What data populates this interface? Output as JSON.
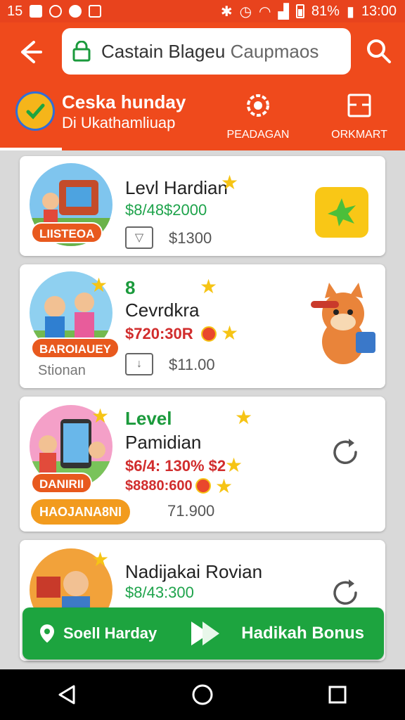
{
  "status_bar": {
    "left_number": "15",
    "battery_percent": "81%",
    "time": "13:00"
  },
  "header": {
    "search_value": "Castain Blageu",
    "search_placeholder": "Caupmaos",
    "active_tab": {
      "title": "Ceska hunday",
      "subtitle": "Di Ukathamliuap"
    },
    "tabs": [
      {
        "label": "PEADAGAN",
        "icon": "radar-icon"
      },
      {
        "label": "ORKMART",
        "icon": "store-icon"
      }
    ]
  },
  "cards": [
    {
      "title": "Levl Hardian",
      "green_text": "$8/48$2000",
      "price": "$1300",
      "thumb_label": "LIISTEOA"
    },
    {
      "green_text": "8",
      "title": "Cevrdkra",
      "red_text": "$720:30R",
      "price": "$11.00",
      "thumb_label": "BAROIAUEY",
      "sub_label": "Stionan"
    },
    {
      "level_label": "Level",
      "title": "Pamidian",
      "red_text": "$6/4: 130% $2",
      "red_text_2": "$8880:600",
      "thumb_label": "DANIRII",
      "orange_tag": "HAOJANA8NI",
      "price": "71.900"
    },
    {
      "title": "Nadijakai Rovian",
      "green_text": "$8/43:300"
    }
  ],
  "bonus_bar": {
    "left_label": "Soell Harday",
    "right_label": "Hadikah Bonus"
  },
  "colors": {
    "header": "#ef4a1c",
    "bonus": "#1da43f",
    "gold": "#f6c415"
  }
}
